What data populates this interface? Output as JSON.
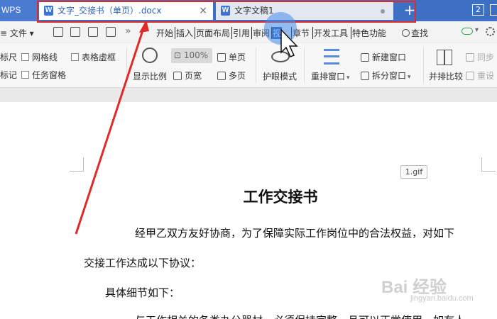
{
  "app": {
    "name": "WPS"
  },
  "tabs": [
    {
      "label": "文字_交接书（单页）.docx",
      "icon": "W",
      "close": "×"
    },
    {
      "label": "文字文稿1",
      "icon": "W"
    }
  ],
  "tab_add": "+",
  "window_count": "2",
  "menubar": {
    "file_label": "≡ 文件 ▾",
    "more_chevron": "»",
    "tabs": [
      "开始",
      "插入",
      "页面布局",
      "引用",
      "审阅",
      "视",
      "章节",
      "开发工具",
      "特色功能"
    ],
    "active_tab": "视",
    "search_label": "查找"
  },
  "ribbon": {
    "checkbox_ruler": "标尺",
    "checkbox_gridlines": "网格线",
    "checkbox_table_gridlines": "表格虚框",
    "checkbox_marks": "标记",
    "checkbox_task_pane": "任务窗格",
    "zoom_label": "显示比例",
    "zoom_value": "100%",
    "page_width": "页宽",
    "single_page": "单页",
    "multi_page": "多页",
    "eye_mode": "护眼模式",
    "rearrange_window": "重排窗口",
    "new_window": "新建窗口",
    "split_window": "拆分窗口",
    "side_by_side": "并排比较",
    "sync": "同步",
    "reset": "重设"
  },
  "document": {
    "image_label": "1.gif",
    "title": "工作交接书",
    "paragraphs": [
      "经甲乙双方友好协商，为了保障实际工作岗位中的合法权益，对如下",
      "交接工作达成以下协议：",
      "具体细节如下：",
      "与工作相关的各类办公器材，必须保持完整，且可以正常使用，如有人"
    ]
  },
  "watermark": {
    "logo": "Bai 经验",
    "url": "jingyan.baidu.com"
  },
  "colors": {
    "tab_bar": "#3d6fc4",
    "active_menu": "#2d5fb8",
    "highlight": "#e02a2a",
    "click_circle": "#4a8cea"
  }
}
